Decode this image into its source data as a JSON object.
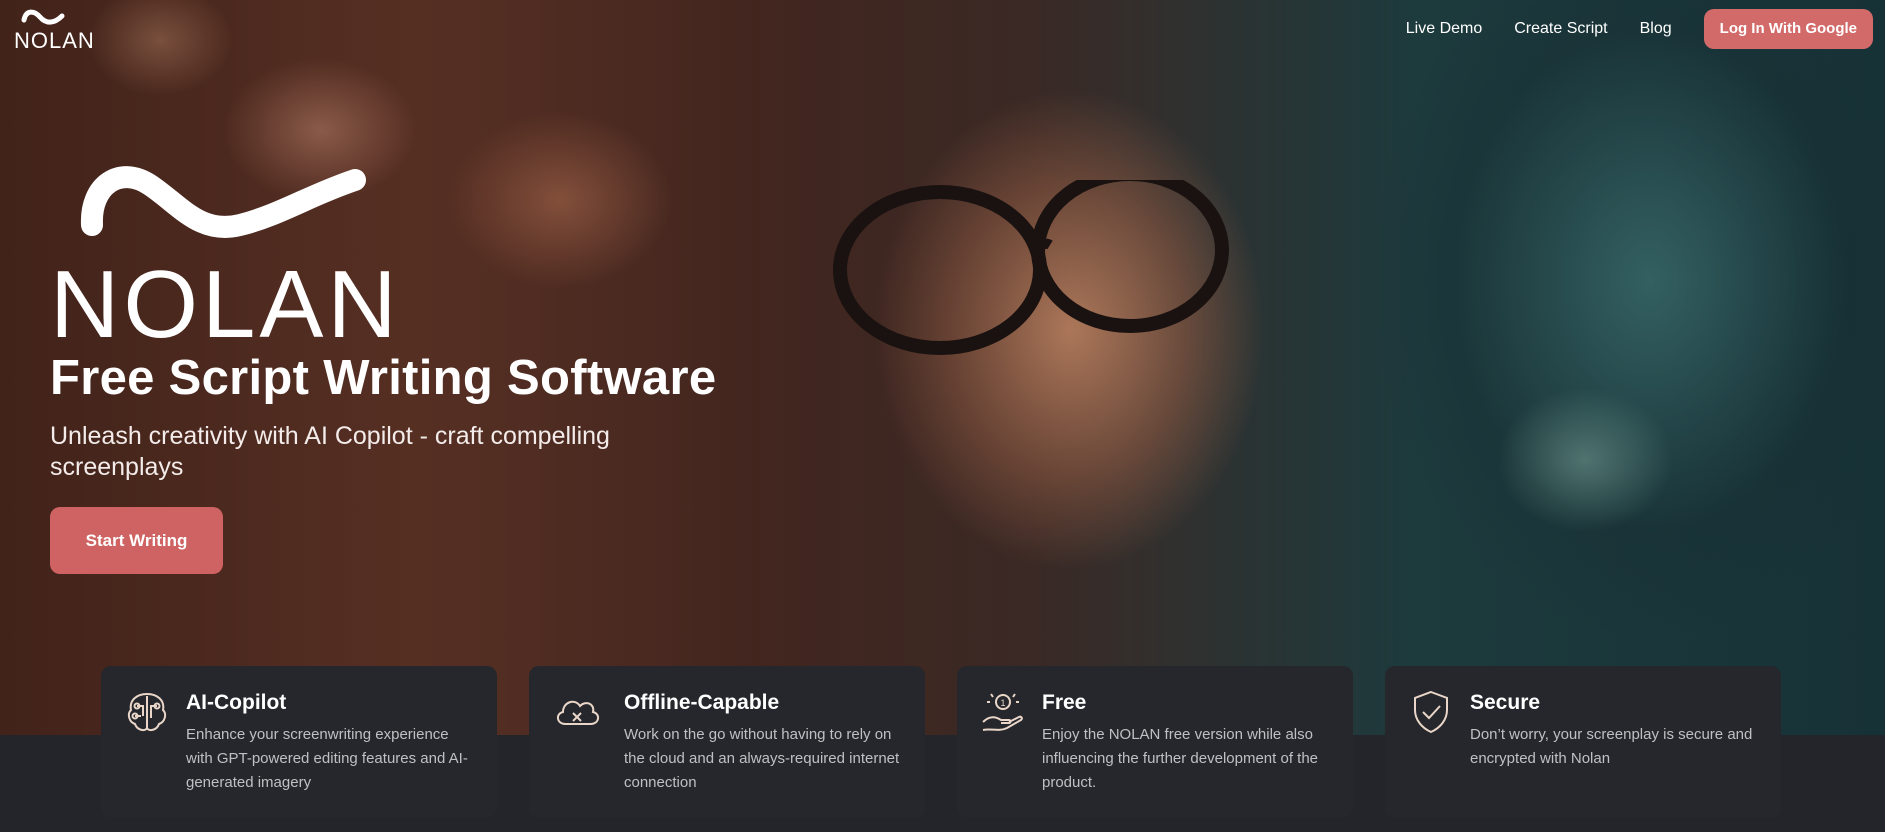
{
  "brand": {
    "name": "NOLAN"
  },
  "nav": {
    "items": [
      {
        "label": "Live Demo"
      },
      {
        "label": "Create Script"
      },
      {
        "label": "Blog"
      }
    ],
    "login_label": "Log In With Google"
  },
  "hero": {
    "logo_text": "NOLAN",
    "title": "Free Script Writing Software",
    "subtitle": "Unleash creativity with AI Copilot - craft compelling screenplays",
    "cta_label": "Start Writing"
  },
  "features": [
    {
      "icon": "brain-circuit-icon",
      "title": "AI-Copilot",
      "description": "Enhance your screenwriting experience with GPT-powered editing features and AI-generated imagery"
    },
    {
      "icon": "cloud-offline-icon",
      "title": "Offline-Capable",
      "description": "Work on the go without having to rely on the cloud and an always-required internet connection"
    },
    {
      "icon": "hand-coin-icon",
      "title": "Free",
      "description": "Enjoy the NOLAN free version while also influencing the further development of the product."
    },
    {
      "icon": "shield-check-icon",
      "title": "Secure",
      "description": "Don’t worry, your screenplay is secure and encrypted with Nolan"
    }
  ],
  "colors": {
    "accent": "#cf6363",
    "card_bg": "#25272c",
    "page_bg": "#1f2126"
  }
}
